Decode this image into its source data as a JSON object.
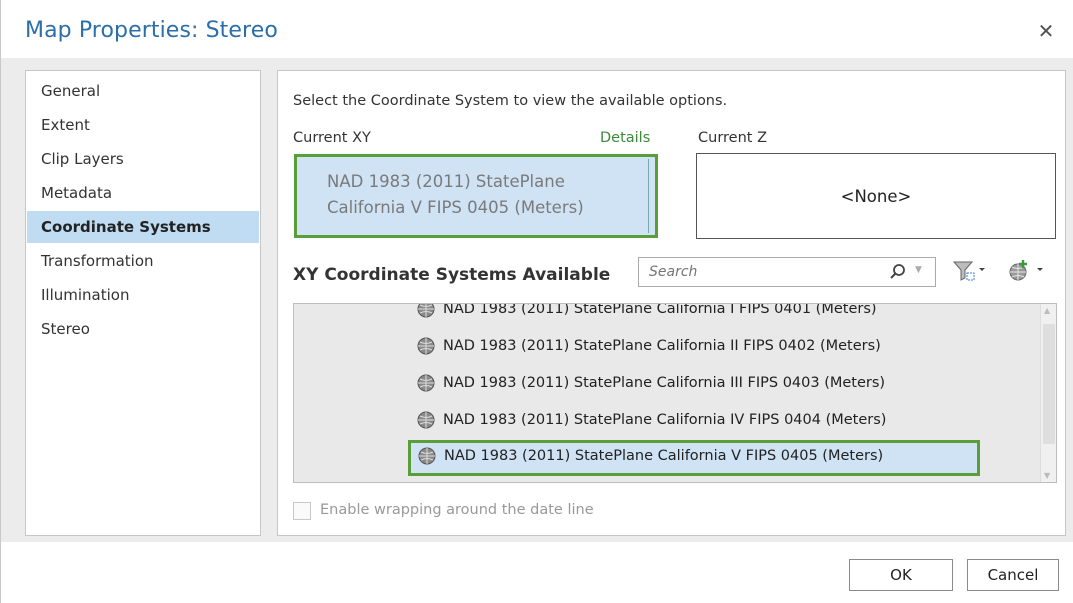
{
  "window": {
    "title": "Map Properties: Stereo",
    "close_glyph": "✕"
  },
  "nav": {
    "items": [
      {
        "label": "General"
      },
      {
        "label": "Extent"
      },
      {
        "label": "Clip Layers"
      },
      {
        "label": "Metadata"
      },
      {
        "label": "Coordinate Systems",
        "active": true
      },
      {
        "label": "Transformation"
      },
      {
        "label": "Illumination"
      },
      {
        "label": "Stereo"
      }
    ]
  },
  "content": {
    "instruction": "Select the Coordinate System to view the available options.",
    "current_xy_label": "Current XY",
    "details_link": "Details",
    "current_z_label": "Current Z",
    "current_xy_line1": "NAD 1983 (2011) StatePlane",
    "current_xy_line2": "California V FIPS 0405 (Meters)",
    "current_z_value": "<None>",
    "available_title": "XY Coordinate Systems Available",
    "search_placeholder": "Search",
    "list_items": [
      "NAD 1983 (2011) StatePlane California I FIPS 0401 (Meters)",
      "NAD 1983 (2011) StatePlane California II FIPS 0402 (Meters)",
      "NAD 1983 (2011) StatePlane California III FIPS 0403 (Meters)",
      "NAD 1983 (2011) StatePlane California IV FIPS 0404 (Meters)",
      "NAD 1983 (2011) StatePlane California V FIPS 0405 (Meters)"
    ],
    "wrap_label": "Enable wrapping around the date line"
  },
  "footer": {
    "ok_label": "OK",
    "cancel_label": "Cancel"
  },
  "colors": {
    "title": "#2b6ea8",
    "selection_fill": "#cfe3f4",
    "highlight_border": "#5a9e3a",
    "nav_active": "#bfdcf2",
    "details_link": "#3c8a3c"
  }
}
